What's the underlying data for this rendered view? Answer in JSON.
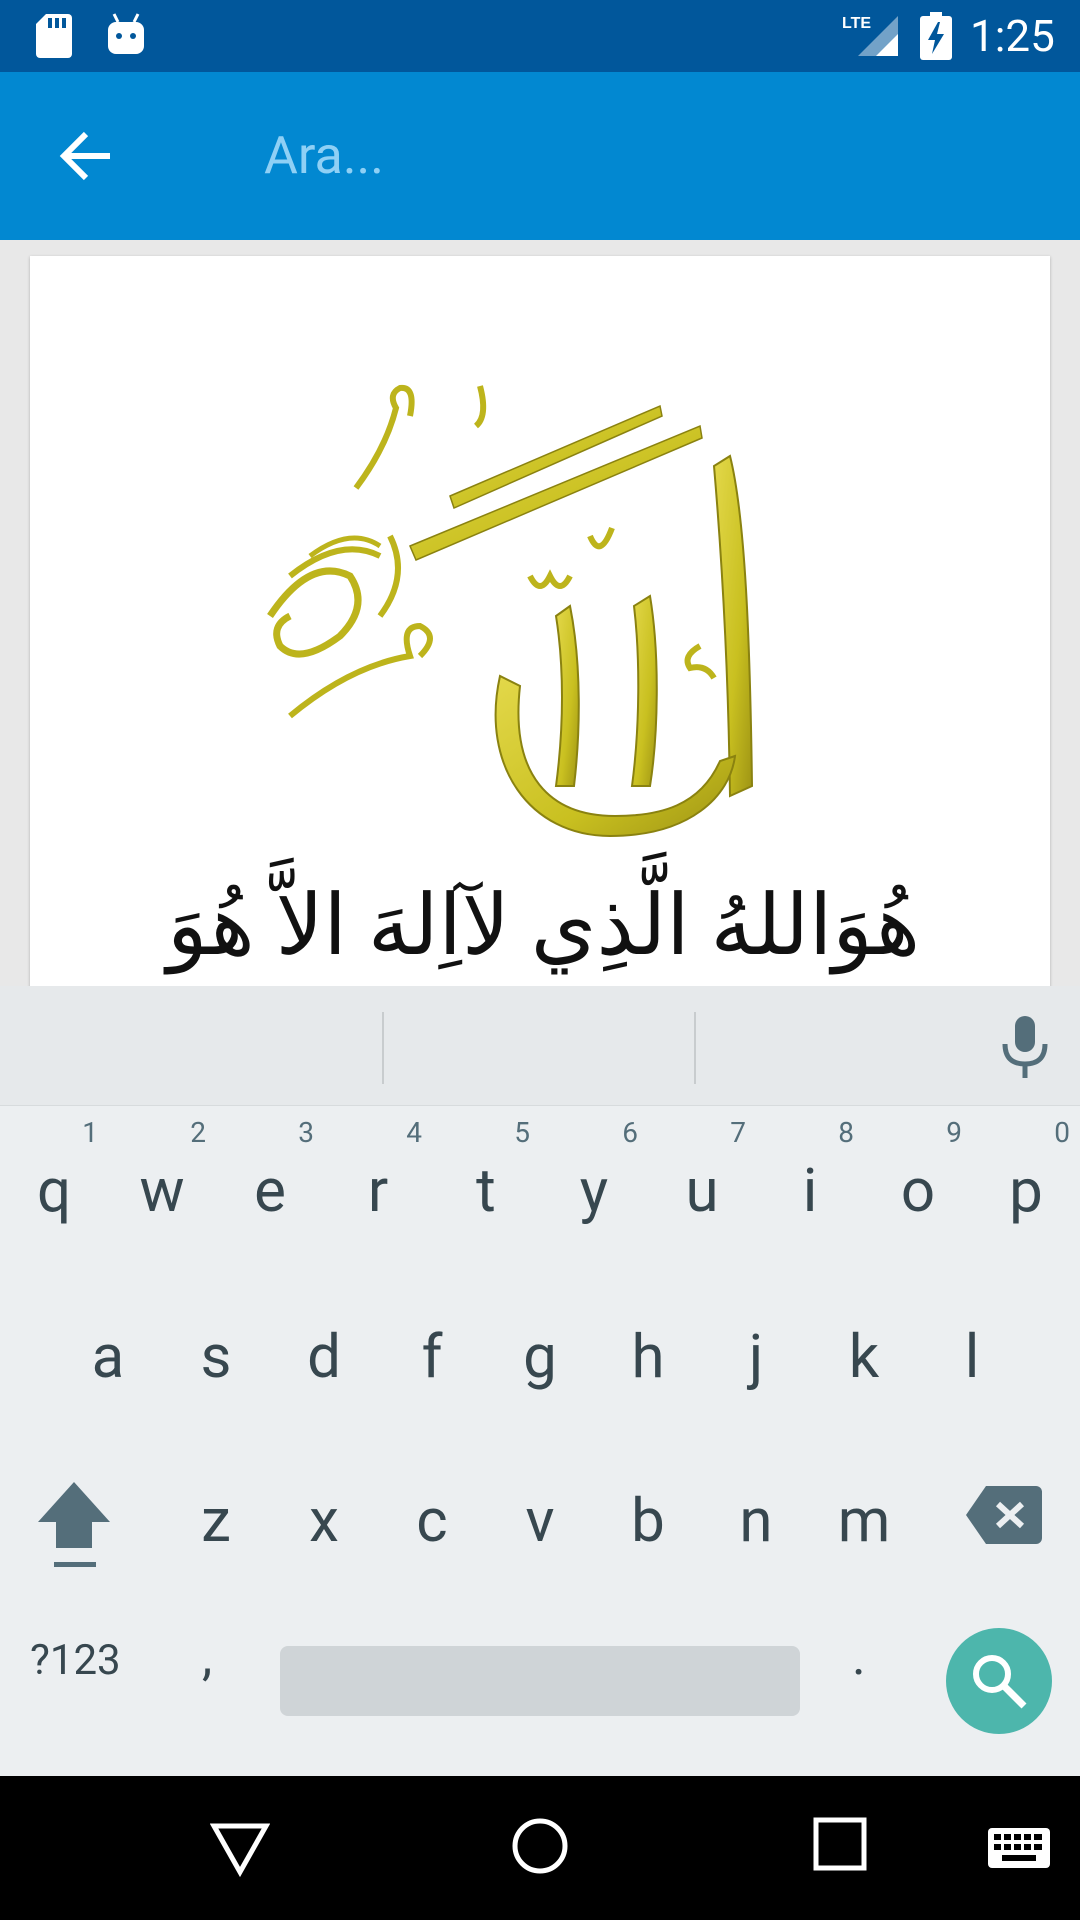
{
  "status_bar": {
    "time": "1:25",
    "network": "LTE",
    "icons": [
      "sd-card-icon",
      "android-debug-icon",
      "lte-signal-icon",
      "battery-charging-icon"
    ]
  },
  "app_bar": {
    "query": "Ara...",
    "back_icon": "arrow-back-icon"
  },
  "content": {
    "calligraphy_image": "allah-calligraphy-image",
    "arabic_text": "هُوَاللهُ الَّذِي لآاِلهَ الاَّ هُوَ"
  },
  "keyboard": {
    "row1": [
      {
        "key": "q",
        "num": "1"
      },
      {
        "key": "w",
        "num": "2"
      },
      {
        "key": "e",
        "num": "3"
      },
      {
        "key": "r",
        "num": "4"
      },
      {
        "key": "t",
        "num": "5"
      },
      {
        "key": "y",
        "num": "6"
      },
      {
        "key": "u",
        "num": "7"
      },
      {
        "key": "i",
        "num": "8"
      },
      {
        "key": "o",
        "num": "9"
      },
      {
        "key": "p",
        "num": "0"
      }
    ],
    "row2": [
      "a",
      "s",
      "d",
      "f",
      "g",
      "h",
      "j",
      "k",
      "l"
    ],
    "row3": [
      "z",
      "x",
      "c",
      "v",
      "b",
      "n",
      "m"
    ],
    "symbols_label": "?123",
    "comma_label": ",",
    "period_label": ".",
    "accent_color": "#4db6ac"
  },
  "nav_bar": {
    "icons": [
      "back-triangle-icon",
      "home-circle-icon",
      "recents-square-icon",
      "keyboard-switch-icon"
    ]
  }
}
